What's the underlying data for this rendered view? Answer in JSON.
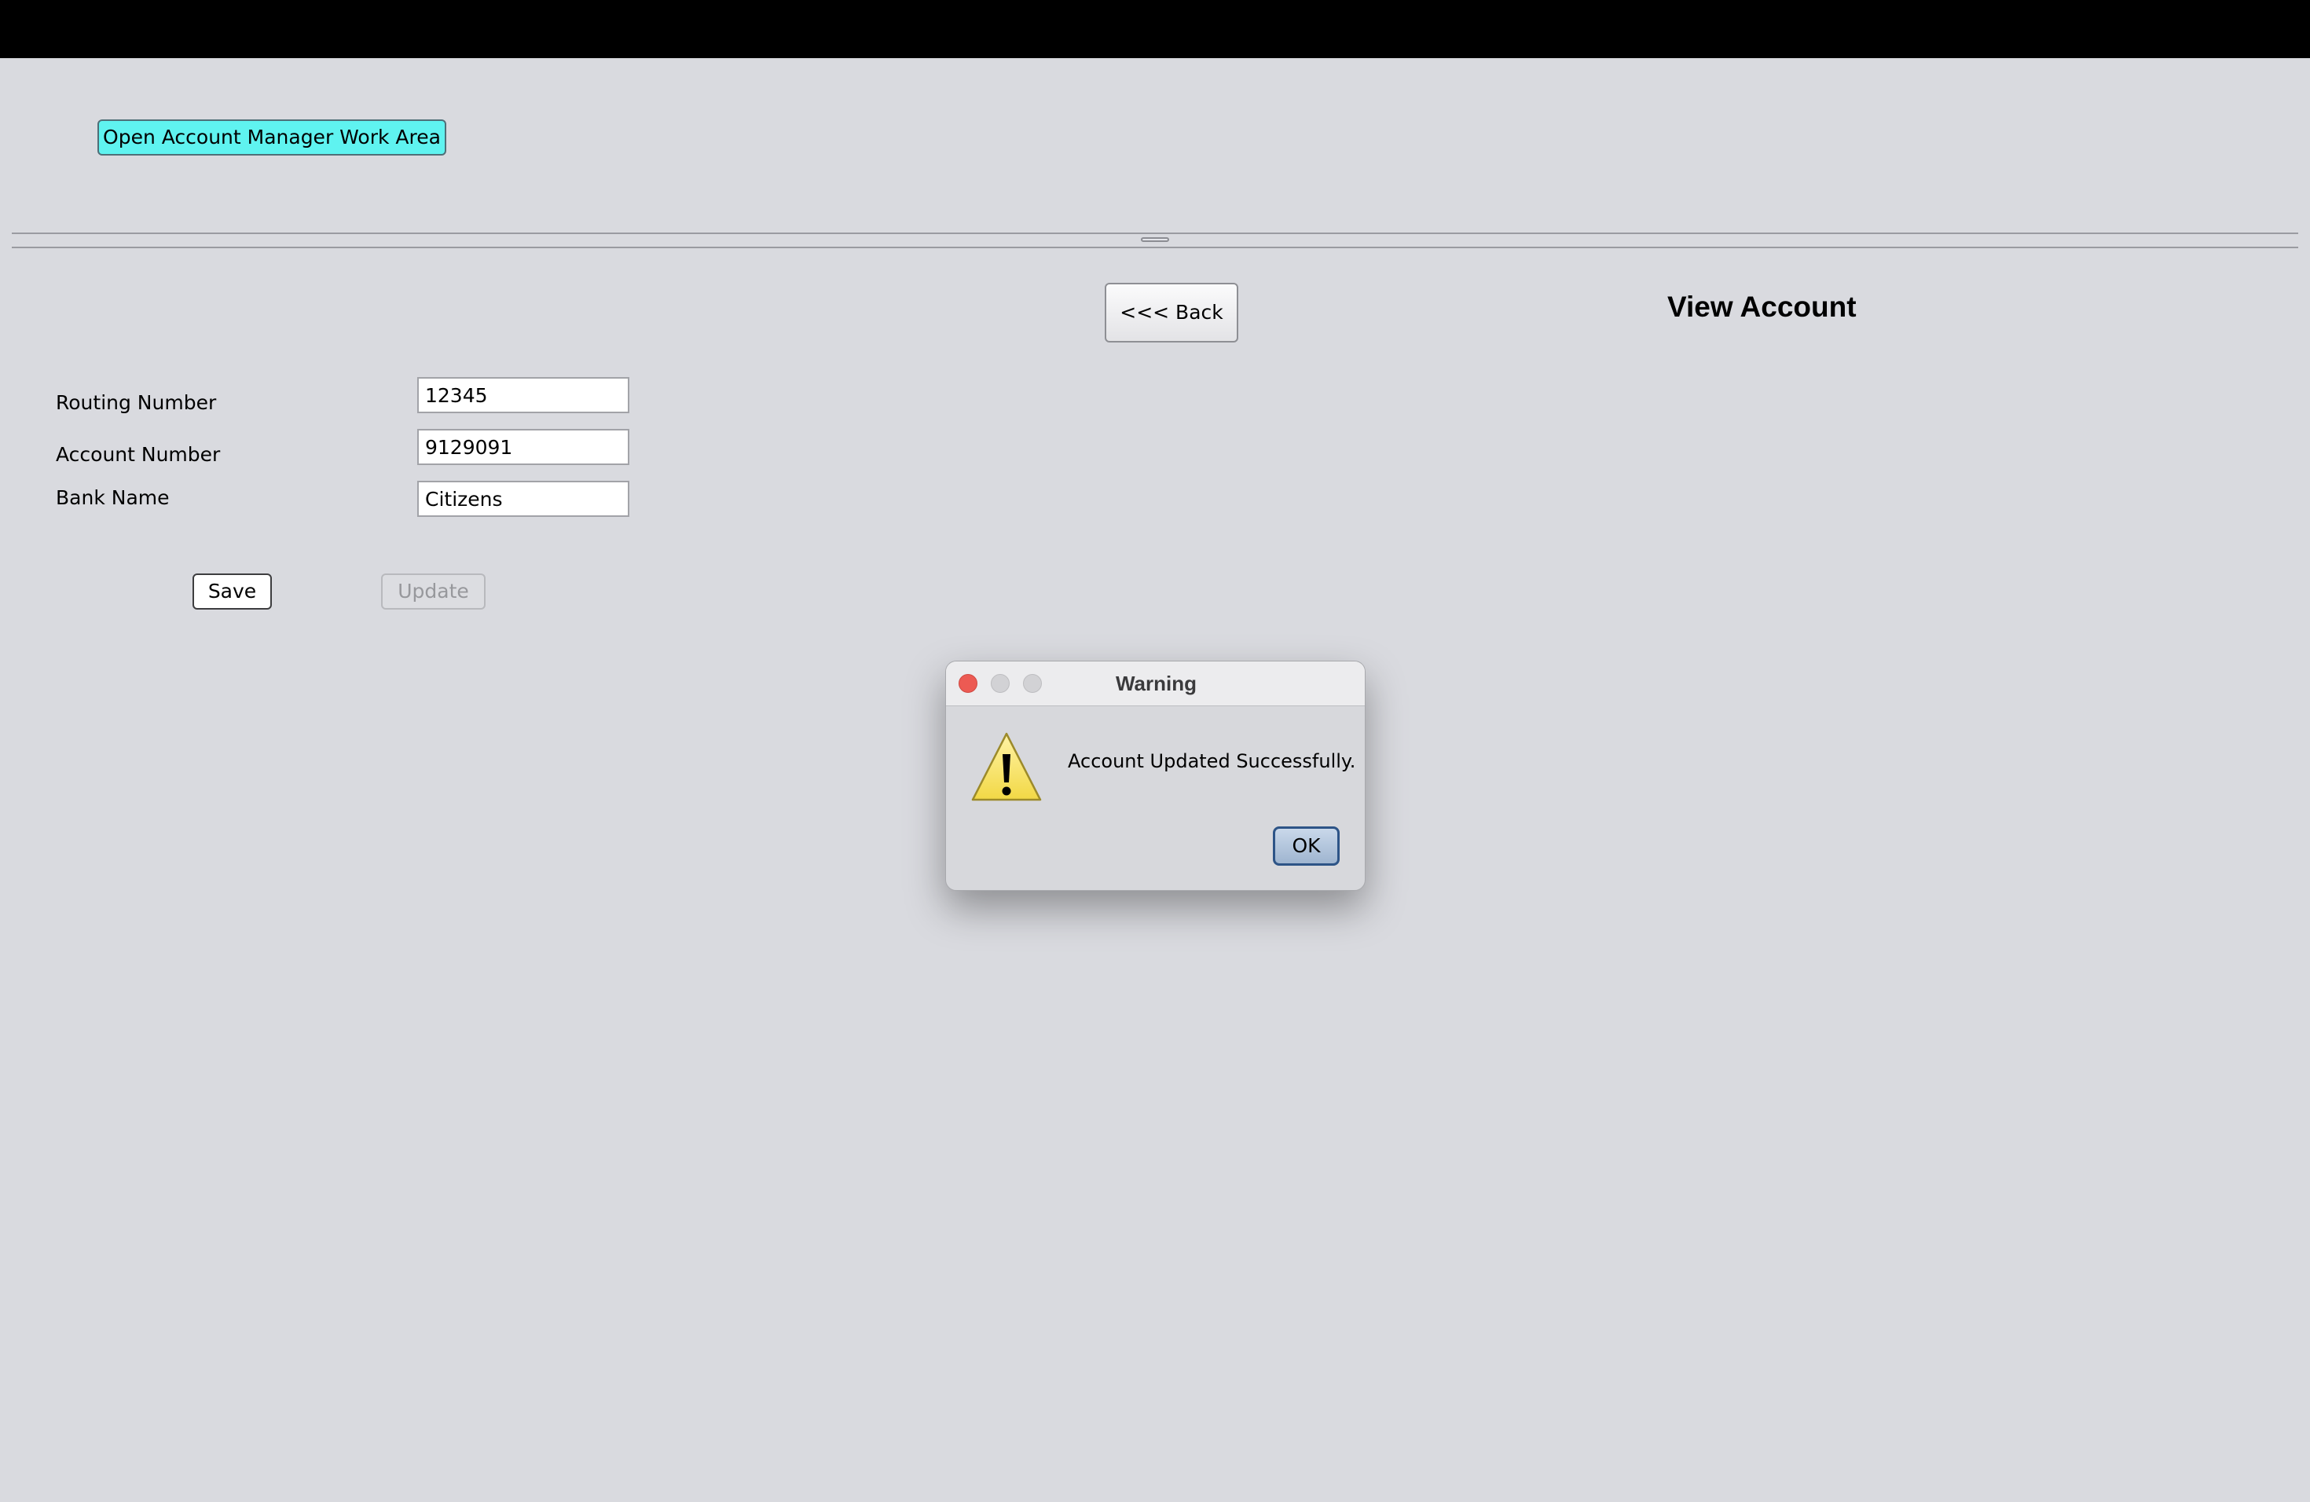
{
  "toolbar": {
    "work_area_label": "Open Account Manager Work Area"
  },
  "header": {
    "back_label": "<<< Back",
    "title": "View Account"
  },
  "form": {
    "routing_label": "Routing Number",
    "routing_value": "12345",
    "account_label": "Account Number",
    "account_value": "9129091",
    "bank_label": "Bank Name",
    "bank_value": "Citizens",
    "save_label": "Save",
    "update_label": "Update"
  },
  "dialog": {
    "title": "Warning",
    "message": "Account Updated Successfully.",
    "ok_label": "OK",
    "icon": "warning-triangle-icon"
  },
  "colors": {
    "background": "#d9dadf",
    "work_area_button": "#5ff3f0",
    "close_button": "#ec5a53",
    "warning_icon": "#f8e36a"
  }
}
